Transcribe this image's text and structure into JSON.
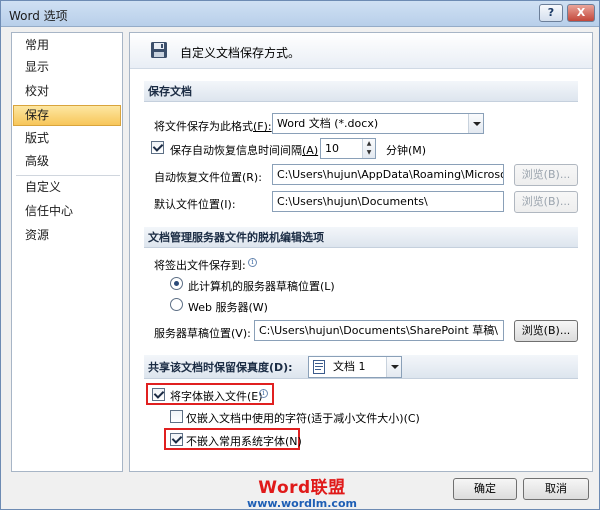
{
  "window": {
    "title": "Word 选项",
    "help_button": "?",
    "close_button": "X"
  },
  "sidebar": {
    "items": [
      {
        "label": "常用"
      },
      {
        "label": "显示"
      },
      {
        "label": "校对"
      },
      {
        "label": "保存",
        "selected": true
      },
      {
        "label": "版式"
      },
      {
        "label": "高级"
      },
      {
        "label": "自定义"
      },
      {
        "label": "信任中心"
      },
      {
        "label": "资源"
      }
    ]
  },
  "header": {
    "icon": "floppy-disk-icon",
    "text": "自定义文档保存方式。"
  },
  "save_docs": {
    "section_title": "保存文档",
    "format_label": "将文件保存为此格式",
    "format_key": "(F):",
    "format_value": "Word 文档 (*.docx)",
    "autorecover_checked": true,
    "autorecover_label": "保存自动恢复信息时间间隔",
    "autorecover_key": "(A)",
    "autorecover_minutes": "10",
    "minutes_label": "分钟(M)",
    "autorecover_location_label": "自动恢复文件位置(R):",
    "autorecover_location_value": "C:\\Users\\hujun\\AppData\\Roaming\\Microsoft\\",
    "browse_label": "浏览(B)...",
    "default_location_label": "默认文件位置(I):",
    "default_location_value": "C:\\Users\\hujun\\Documents\\",
    "browse2_label": "浏览(B)..."
  },
  "offline": {
    "section_title": "文档管理服务器文件的脱机编辑选项",
    "checkout_label": "将签出文件保存到:",
    "radio_local_label": "此计算机的服务器草稿位置(L)",
    "radio_local_selected": true,
    "radio_web_label": "Web 服务器(W)",
    "radio_web_selected": false,
    "drafts_label": "服务器草稿位置(V):",
    "drafts_value": "C:\\Users\\hujun\\Documents\\SharePoint 草稿\\",
    "browse_label": "浏览(B)..."
  },
  "fidelity": {
    "section_title": "共享该文档时保留保真度(D):",
    "doc_value": "文档 1",
    "embed_fonts_checked": true,
    "embed_fonts_label": "将字体嵌入文件(E)",
    "embed_used_checked": false,
    "embed_used_label": "仅嵌入文档中使用的字符(适于减小文件大小)(C)",
    "no_common_checked": true,
    "no_common_label": "不嵌入常用系统字体(N)"
  },
  "footer": {
    "ok_label": "确定",
    "cancel_label": "取消"
  },
  "watermark": {
    "brand": "Word联盟",
    "url": "www.wordlm.com"
  }
}
